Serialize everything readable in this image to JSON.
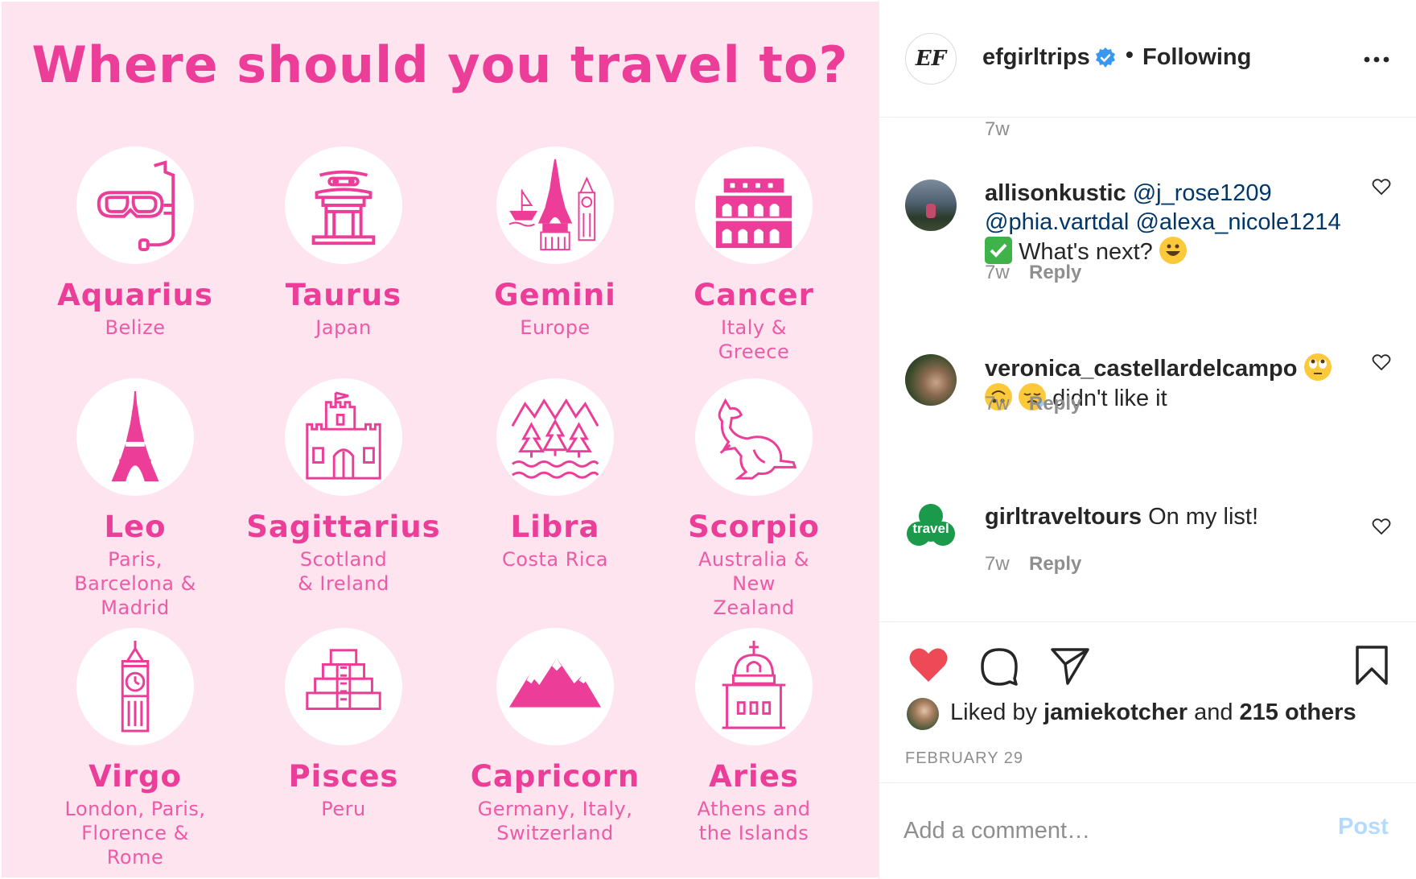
{
  "poster": {
    "title": "Where should you travel to?",
    "signs": [
      {
        "name": "Aquarius",
        "dest": "Belize",
        "icon": "snorkel-mask-icon"
      },
      {
        "name": "Taurus",
        "dest": "Japan",
        "icon": "japanese-gate-icon"
      },
      {
        "name": "Gemini",
        "dest": "Europe",
        "icon": "europe-landmarks-icon"
      },
      {
        "name": "Cancer",
        "dest": "Italy &\nGreece",
        "icon": "colosseum-icon"
      },
      {
        "name": "Leo",
        "dest": "Paris,\nBarcelona &\nMadrid",
        "icon": "eiffel-tower-icon"
      },
      {
        "name": "Sagittarius",
        "dest": "Scotland\n& Ireland",
        "icon": "castle-icon"
      },
      {
        "name": "Libra",
        "dest": "Costa Rica",
        "icon": "forest-icon"
      },
      {
        "name": "Scorpio",
        "dest": "Australia &\nNew\nZealand",
        "icon": "kangaroo-icon"
      },
      {
        "name": "Virgo",
        "dest": "London, Paris,\nFlorence &\nRome",
        "icon": "big-ben-icon"
      },
      {
        "name": "Pisces",
        "dest": "Peru",
        "icon": "pyramid-icon"
      },
      {
        "name": "Capricorn",
        "dest": "Germany, Italy,\nSwitzerland",
        "icon": "mountains-icon"
      },
      {
        "name": "Aries",
        "dest": "Athens and\nthe Islands",
        "icon": "greek-chapel-icon"
      }
    ]
  },
  "header": {
    "avatar_text": "EF",
    "username": "efgirltrips",
    "separator": "•",
    "follow_status": "Following"
  },
  "comments": {
    "prev_time": "7w",
    "items": [
      {
        "user": "allisonkustic",
        "mentions": [
          "@j_rose1209",
          "@phia.vartdal",
          "@alexa_nicole1214"
        ],
        "text": "What's next?",
        "time": "7w",
        "reply": "Reply"
      },
      {
        "user": "veronica_castellardelcampo",
        "text": "didn't like it",
        "time": "7w",
        "reply": "Reply"
      },
      {
        "user": "girltraveltours",
        "text": "On my list!",
        "time": "7w",
        "reply": "Reply",
        "avatar_text": "travel"
      }
    ]
  },
  "likes": {
    "prefix": "Liked by",
    "user": "jamiekotcher",
    "and": "and",
    "others": "215 others"
  },
  "date": "FEBRUARY 29",
  "comment_box": {
    "placeholder": "Add a comment…",
    "post_label": "Post"
  },
  "colors": {
    "poster_bg": "#fde4ee",
    "poster_pink": "#ec3d98",
    "like_red": "#ed4956",
    "verified_blue": "#3897f0",
    "post_disabled": "#b3dbff",
    "travel_green": "#1a9a4a"
  }
}
